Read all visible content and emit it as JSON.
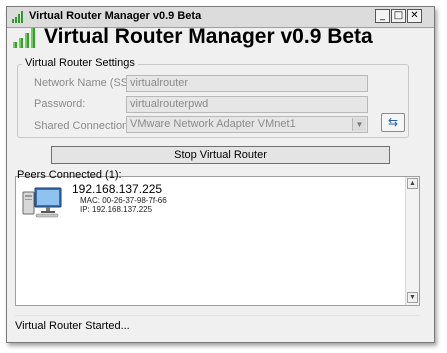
{
  "window": {
    "title": "Virtual Router Manager v0.9 Beta"
  },
  "header": {
    "title": "Virtual Router Manager v0.9 Beta"
  },
  "settings": {
    "group_label": "Virtual Router Settings",
    "ssid_label": "Network Name (SSID):",
    "ssid_value": "virtualrouter",
    "password_label": "Password:",
    "password_value": "virtualrouterpwd",
    "shared_label": "Shared Connection:",
    "shared_value": "VMware Network Adapter VMnet1"
  },
  "actions": {
    "stop_label": "Stop Virtual Router"
  },
  "peers": {
    "label": "Peers Connected (1):",
    "items": [
      {
        "ip": "192.168.137.225",
        "mac": "MAC: 00-26-37-98-7f-66",
        "ip_detail": "IP: 192.168.137.225"
      }
    ]
  },
  "status": {
    "text": "Virtual Router Started..."
  },
  "icons": {
    "app": "signal-bars-icon",
    "refresh": "refresh-icon",
    "peer": "computer-icon"
  },
  "colors": {
    "accent_green": "#2f9b2f",
    "refresh_blue": "#2860b0"
  }
}
